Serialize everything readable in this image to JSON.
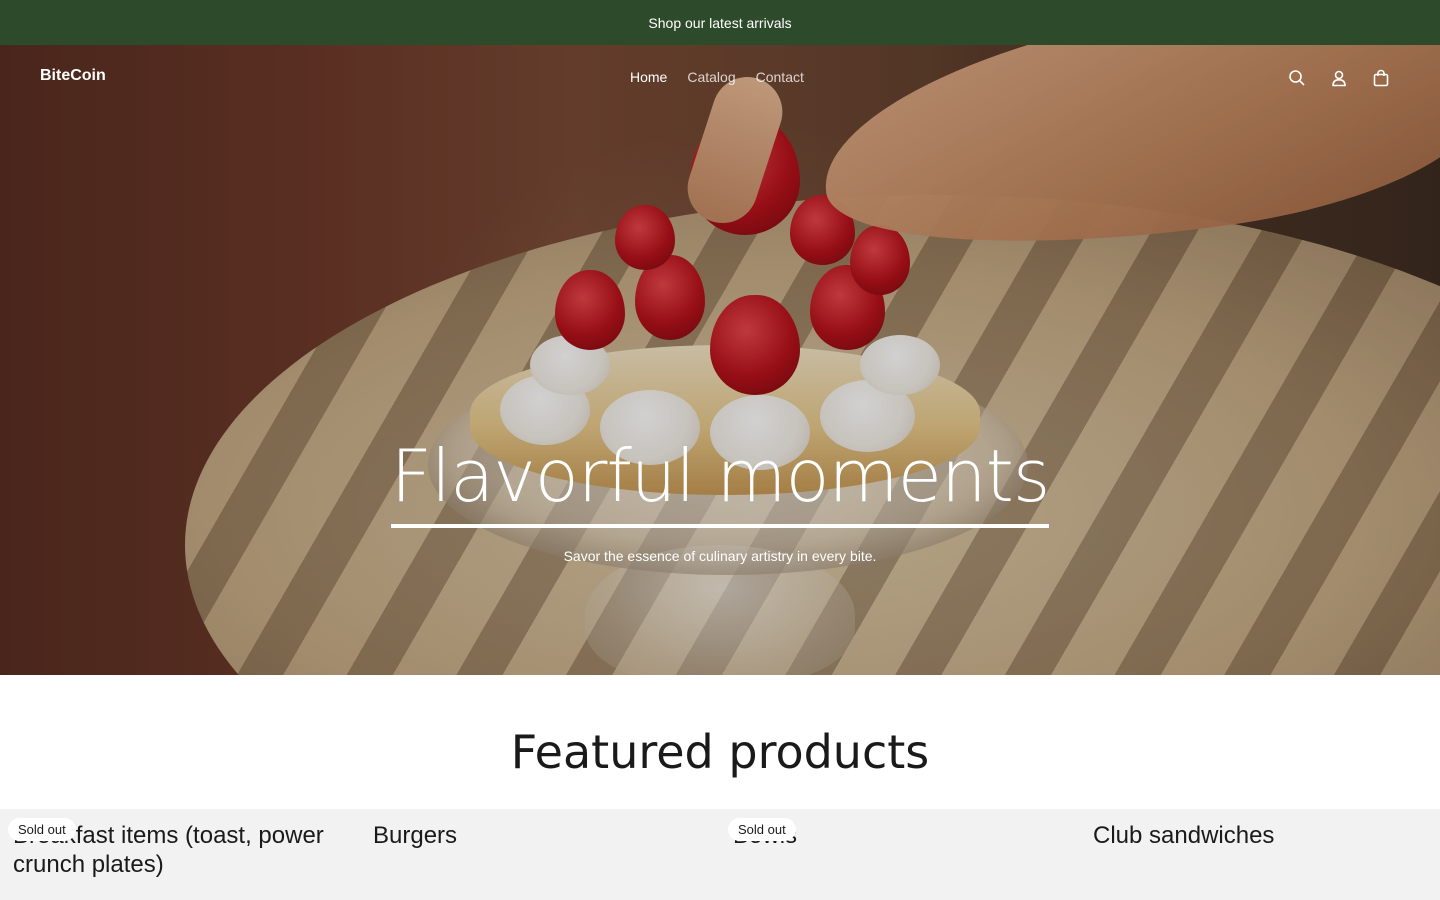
{
  "announcement": {
    "text": "Shop our latest arrivals"
  },
  "header": {
    "logo": "BiteCoin",
    "nav": [
      {
        "label": "Home",
        "active": true
      },
      {
        "label": "Catalog",
        "active": false
      },
      {
        "label": "Contact",
        "active": false
      }
    ],
    "icons": [
      "search-icon",
      "account-icon",
      "cart-icon"
    ]
  },
  "hero": {
    "title": "Flavorful moments",
    "subtitle": "Savor the essence of culinary artistry in every bite."
  },
  "featured": {
    "title": "Featured products",
    "products": [
      {
        "name": "Breakfast items (toast, power crunch plates)",
        "badge": "Sold out"
      },
      {
        "name": "Burgers",
        "badge": ""
      },
      {
        "name": "Bowls",
        "badge": "Sold out"
      },
      {
        "name": "Club sandwiches",
        "badge": ""
      }
    ]
  },
  "colors": {
    "announcement_bg": "#2d4a2b",
    "products_bg": "#f2f2f2"
  }
}
